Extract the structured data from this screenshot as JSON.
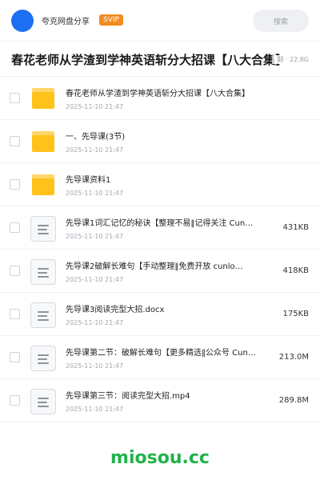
{
  "header": {
    "share_name": "夸克网盘分享",
    "badge": "SVIP",
    "search_label": "搜索",
    "avatar_color": "#1d6ff2"
  },
  "title_bar": {
    "title": "春花老师从学渣到学神英语斩分大招课【八大合集】",
    "meta": "期 · 22.8G"
  },
  "files": [
    {
      "type": "folder",
      "name": "春花老师从学渣到学神英语斩分大招课【八大合集】",
      "date": "2025-11-10 21:47",
      "size": ""
    },
    {
      "type": "folder",
      "name": "一、先导课(3节)",
      "date": "2025-11-10 21:47",
      "size": ""
    },
    {
      "type": "folder",
      "name": "先导课资料1",
      "date": "2025-11-10 21:47",
      "size": ""
    },
    {
      "type": "file",
      "name": "先导课1词汇记忆的秘诀【整理不易‖记得关注 Cun…",
      "date": "2025-11-10 21:47",
      "size": "431KB"
    },
    {
      "type": "file",
      "name": "先导课2破解长难句【手动整理‖免费开放 cunlo…",
      "date": "2025-11-10 21:47",
      "size": "418KB"
    },
    {
      "type": "file",
      "name": "先导课3阅读完型大招.docx",
      "date": "2025-11-10 21:47",
      "size": "175KB"
    },
    {
      "type": "file",
      "name": "先导课第二节：破解长难句【更多精选‖公众号 Cun…",
      "date": "2025-11-10 21:47",
      "size": "213.0M"
    },
    {
      "type": "file",
      "name": "先导课第三节：阅读完型大招.mp4",
      "date": "2025-11-10 21:47",
      "size": "289.8M"
    }
  ],
  "watermark": "miosou.cc",
  "colors": {
    "accent": "#1d6ff2",
    "svip": "#f28a1f",
    "folder": "#ffc21a",
    "watermark": "#21b24a"
  }
}
